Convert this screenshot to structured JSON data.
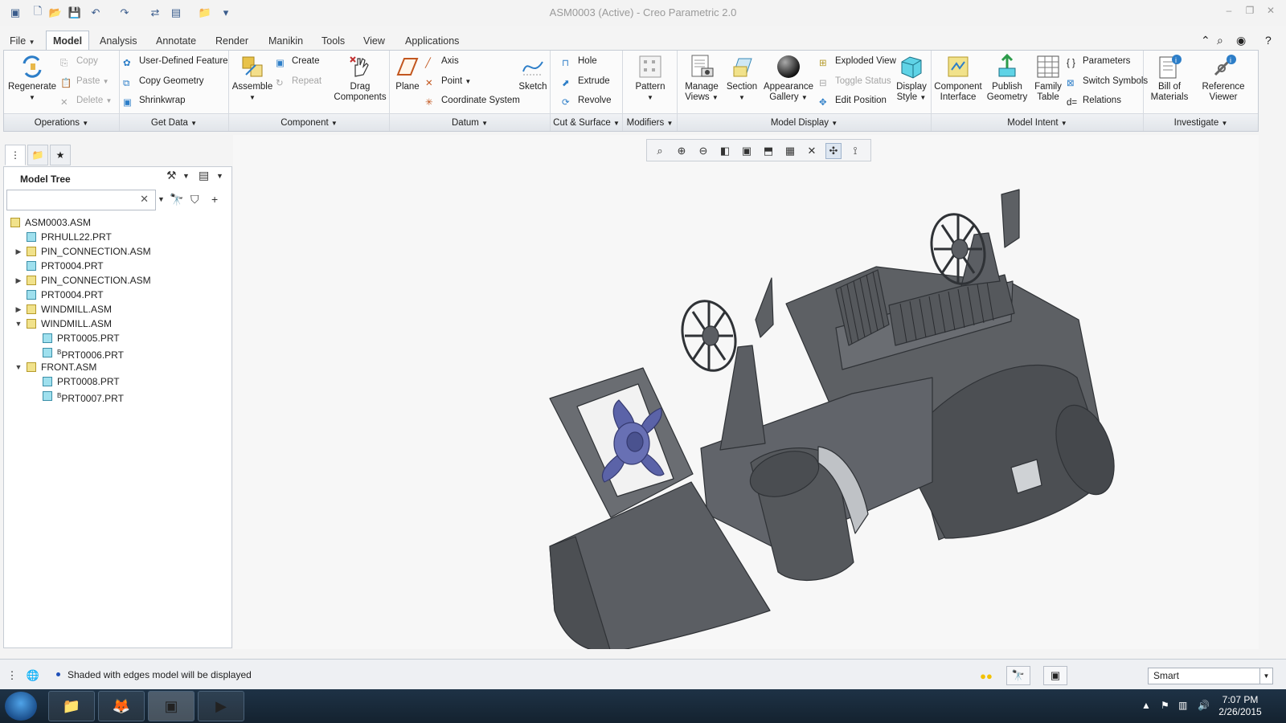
{
  "window": {
    "title": "ASM0003 (Active) - Creo Parametric 2.0"
  },
  "tabs": [
    {
      "label": "File",
      "key": "file"
    },
    {
      "label": "Model",
      "key": "model"
    },
    {
      "label": "Analysis",
      "key": "analysis"
    },
    {
      "label": "Annotate",
      "key": "annotate"
    },
    {
      "label": "Render",
      "key": "render"
    },
    {
      "label": "Manikin",
      "key": "manikin"
    },
    {
      "label": "Tools",
      "key": "tools"
    },
    {
      "label": "View",
      "key": "view"
    },
    {
      "label": "Applications",
      "key": "applications"
    }
  ],
  "ribbon": {
    "operations": {
      "label": "Operations",
      "regenerate": "Regenerate",
      "copy": "Copy",
      "paste": "Paste",
      "delete": "Delete"
    },
    "getdata": {
      "label": "Get Data",
      "udf": "User-Defined Feature",
      "copy_geometry": "Copy Geometry",
      "shrinkwrap": "Shrinkwrap"
    },
    "component": {
      "label": "Component",
      "assemble": "Assemble",
      "create": "Create",
      "repeat": "Repeat",
      "drag1": "Drag",
      "drag2": "Components"
    },
    "datum": {
      "label": "Datum",
      "plane": "Plane",
      "axis": "Axis",
      "point": "Point",
      "csys": "Coordinate System",
      "sketch": "Sketch"
    },
    "cutsurface": {
      "label": "Cut & Surface",
      "hole": "Hole",
      "extrude": "Extrude",
      "revolve": "Revolve"
    },
    "modifiers": {
      "label": "Modifiers",
      "pattern": "Pattern"
    },
    "modeldisplay": {
      "label": "Model Display",
      "manage1": "Manage",
      "manage2": "Views",
      "section": "Section",
      "appearance1": "Appearance",
      "appearance2": "Gallery",
      "exploded": "Exploded View",
      "toggle": "Toggle Status",
      "editpos": "Edit Position",
      "display1": "Display",
      "display2": "Style"
    },
    "modelintent": {
      "label": "Model Intent",
      "compif1": "Component",
      "compif2": "Interface",
      "publish1": "Publish",
      "publish2": "Geometry",
      "family1": "Family",
      "family2": "Table",
      "parameters": "Parameters",
      "switch": "Switch Symbols",
      "relations": "Relations"
    },
    "investigate": {
      "label": "Investigate",
      "bom1": "Bill of",
      "bom2": "Materials",
      "ref1": "Reference",
      "ref2": "Viewer"
    }
  },
  "model_tree": {
    "title": "Model Tree",
    "search_value": "",
    "items": [
      {
        "label": "ASM0003.ASM",
        "type": "asm",
        "level": 0,
        "expander": ""
      },
      {
        "label": "PRHULL22.PRT",
        "type": "prt",
        "level": 1,
        "expander": ""
      },
      {
        "label": "PIN_CONNECTION.ASM",
        "type": "asm",
        "level": 1,
        "expander": "▶"
      },
      {
        "label": "PRT0004.PRT",
        "type": "prt",
        "level": 1,
        "expander": ""
      },
      {
        "label": "PIN_CONNECTION.ASM",
        "type": "asm",
        "level": 1,
        "expander": "▶"
      },
      {
        "label": "PRT0004.PRT",
        "type": "prt",
        "level": 1,
        "expander": ""
      },
      {
        "label": "WINDMILL.ASM",
        "type": "asm",
        "level": 1,
        "expander": "▶"
      },
      {
        "label": "WINDMILL.ASM",
        "type": "asm",
        "level": 1,
        "expander": "▼"
      },
      {
        "label": "PRT0005.PRT",
        "type": "prt",
        "level": 2,
        "expander": ""
      },
      {
        "label": "PRT0006.PRT",
        "type": "prt",
        "level": 2,
        "expander": "",
        "marker": "B"
      },
      {
        "label": "FRONT.ASM",
        "type": "asm",
        "level": 1,
        "expander": "▼"
      },
      {
        "label": "PRT0008.PRT",
        "type": "prt",
        "level": 2,
        "expander": ""
      },
      {
        "label": "PRT0007.PRT",
        "type": "prt",
        "level": 2,
        "expander": "",
        "marker": "B"
      }
    ]
  },
  "status": {
    "message": "Shaded with edges model will be displayed",
    "filter": "Smart"
  },
  "taskbar": {
    "time": "7:07 PM",
    "date": "2/26/2015"
  },
  "colors": {
    "model_gray": "#5d6064",
    "model_dark": "#45484c",
    "propeller": "#5b63a8",
    "accent": "#1e4fb8"
  }
}
